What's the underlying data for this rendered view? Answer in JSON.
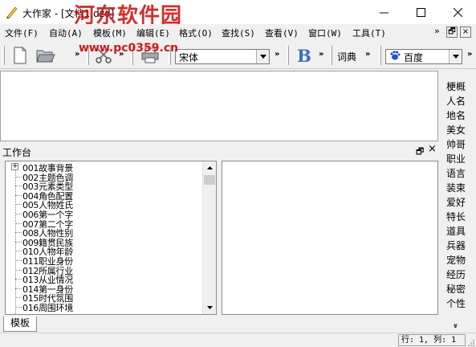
{
  "window": {
    "title": "大作家 - [文档1.dzd]",
    "watermark": "河东软件园",
    "watermark_url": "www.pc0359.cn"
  },
  "menu": {
    "items": [
      "文件(F)",
      "自动(A)",
      "模板(M)",
      "编辑(E)",
      "格式(O)",
      "查找(S)",
      "查看(V)",
      "窗口(W)",
      "工具(T)"
    ],
    "overflow": "»",
    "mdi_restore": "🗗",
    "mdi_close": "×"
  },
  "toolbar": {
    "chevron": "»",
    "font_combo_value": "宋体",
    "bold_label": "B",
    "dict_label": "词典",
    "search_engine_value": "百度"
  },
  "dictionary_panel": {
    "items": [
      "梗概",
      "人名",
      "地名",
      "美女",
      "帅哥",
      "职业",
      "语言",
      "装束",
      "爱好",
      "特长",
      "道具",
      "兵器",
      "宠物",
      "经历",
      "秘密",
      "个性"
    ],
    "more": "»"
  },
  "workbench": {
    "title": "工作台",
    "float": "🗗",
    "close": "×",
    "tree_items": [
      "001故事背景",
      "002主题色调",
      "003元素类型",
      "004角色配置",
      "005人物姓氏",
      "006第一个字",
      "007第二个字",
      "008人物性别",
      "009籍贯民族",
      "010人物年龄",
      "011职业身份",
      "012所属行业",
      "013从业情况",
      "014第一身份",
      "015时代氛围",
      "016周围环境"
    ],
    "expander": "+"
  },
  "tabs": {
    "active": "模板"
  },
  "status": {
    "position": "行: 1, 列: 1"
  }
}
